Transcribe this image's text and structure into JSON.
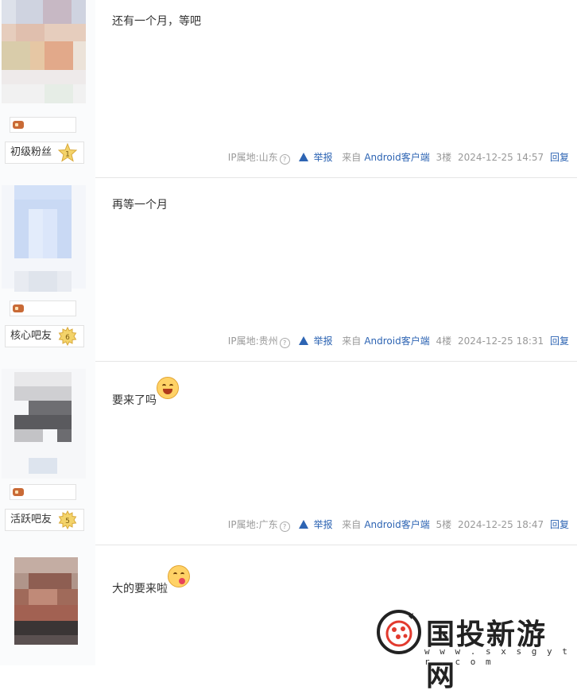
{
  "posts": [
    {
      "content": "还有一个月，等吧",
      "emoji": "",
      "level_title": "初级粉丝",
      "level_num": "1",
      "ip_label": "IP属地:山东",
      "report_label": "举报",
      "source": "来自",
      "client": "Android客户端",
      "floor": "3楼",
      "time": "2024-12-25 14:57",
      "reply_label": "回复"
    },
    {
      "content": "再等一个月",
      "emoji": "",
      "level_title": "核心吧友",
      "level_num": "6",
      "ip_label": "IP属地:贵州",
      "report_label": "举报",
      "source": "来自",
      "client": "Android客户端",
      "floor": "4楼",
      "time": "2024-12-25 18:31",
      "reply_label": "回复"
    },
    {
      "content": "要来了吗",
      "emoji": "laughing-emoji",
      "level_title": "活跃吧友",
      "level_num": "5",
      "ip_label": "IP属地:广东",
      "report_label": "举报",
      "source": "来自",
      "client": "Android客户端",
      "floor": "5楼",
      "time": "2024-12-25 18:47",
      "reply_label": "回复"
    },
    {
      "content": "大的要来啦",
      "emoji": "tongue-out-emoji",
      "level_title": "",
      "level_num": "",
      "ip_label": "",
      "report_label": "",
      "source": "",
      "client": "",
      "floor": "",
      "time": "",
      "reply_label": ""
    }
  ],
  "watermark": {
    "title": "国投新游网",
    "url": "w w w . s x s g y t r . c o m"
  },
  "colors": {
    "link_blue": "#2d64b3",
    "meta_gray": "#999999",
    "divider": "#e5e5e5"
  }
}
